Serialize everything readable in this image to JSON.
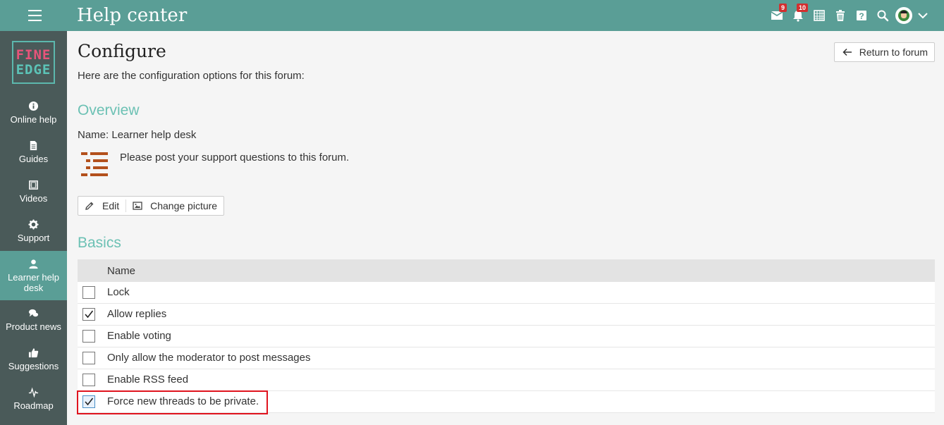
{
  "app": {
    "title": "Help center"
  },
  "topbar": {
    "messages_badge": "9",
    "notifications_badge": "10"
  },
  "logo": {
    "line1": "FINE",
    "line2": "EDGE"
  },
  "sidebar": {
    "items": [
      {
        "label": "Online help",
        "icon": "info-icon"
      },
      {
        "label": "Guides",
        "icon": "document-icon"
      },
      {
        "label": "Videos",
        "icon": "film-icon"
      },
      {
        "label": "Support",
        "icon": "gear-icon"
      },
      {
        "label": "Learner help desk",
        "icon": "user-icon",
        "active": true
      },
      {
        "label": "Product news",
        "icon": "chat-icon"
      },
      {
        "label": "Suggestions",
        "icon": "thumbs-up-icon"
      },
      {
        "label": "Roadmap",
        "icon": "pulse-icon"
      }
    ]
  },
  "page": {
    "title": "Configure",
    "intro": "Here are the configuration options for this forum:",
    "return_label": "Return to forum"
  },
  "overview": {
    "title": "Overview",
    "name_line": "Name: Learner help desk",
    "description": "Please post your support questions to this forum.",
    "edit_label": "Edit",
    "change_picture_label": "Change picture"
  },
  "basics": {
    "title": "Basics",
    "column_name": "Name",
    "options": [
      {
        "label": "Lock",
        "checked": false
      },
      {
        "label": "Allow replies",
        "checked": true
      },
      {
        "label": "Enable voting",
        "checked": false
      },
      {
        "label": "Only allow the moderator to post messages",
        "checked": false
      },
      {
        "label": "Enable RSS feed",
        "checked": false
      },
      {
        "label": "Force new threads to be private.",
        "checked": true
      }
    ]
  },
  "colors": {
    "topbar": "#5a9e96",
    "sidebar": "#4a5a59",
    "section_title": "#6cc1b4",
    "highlight": "#e0141e"
  }
}
